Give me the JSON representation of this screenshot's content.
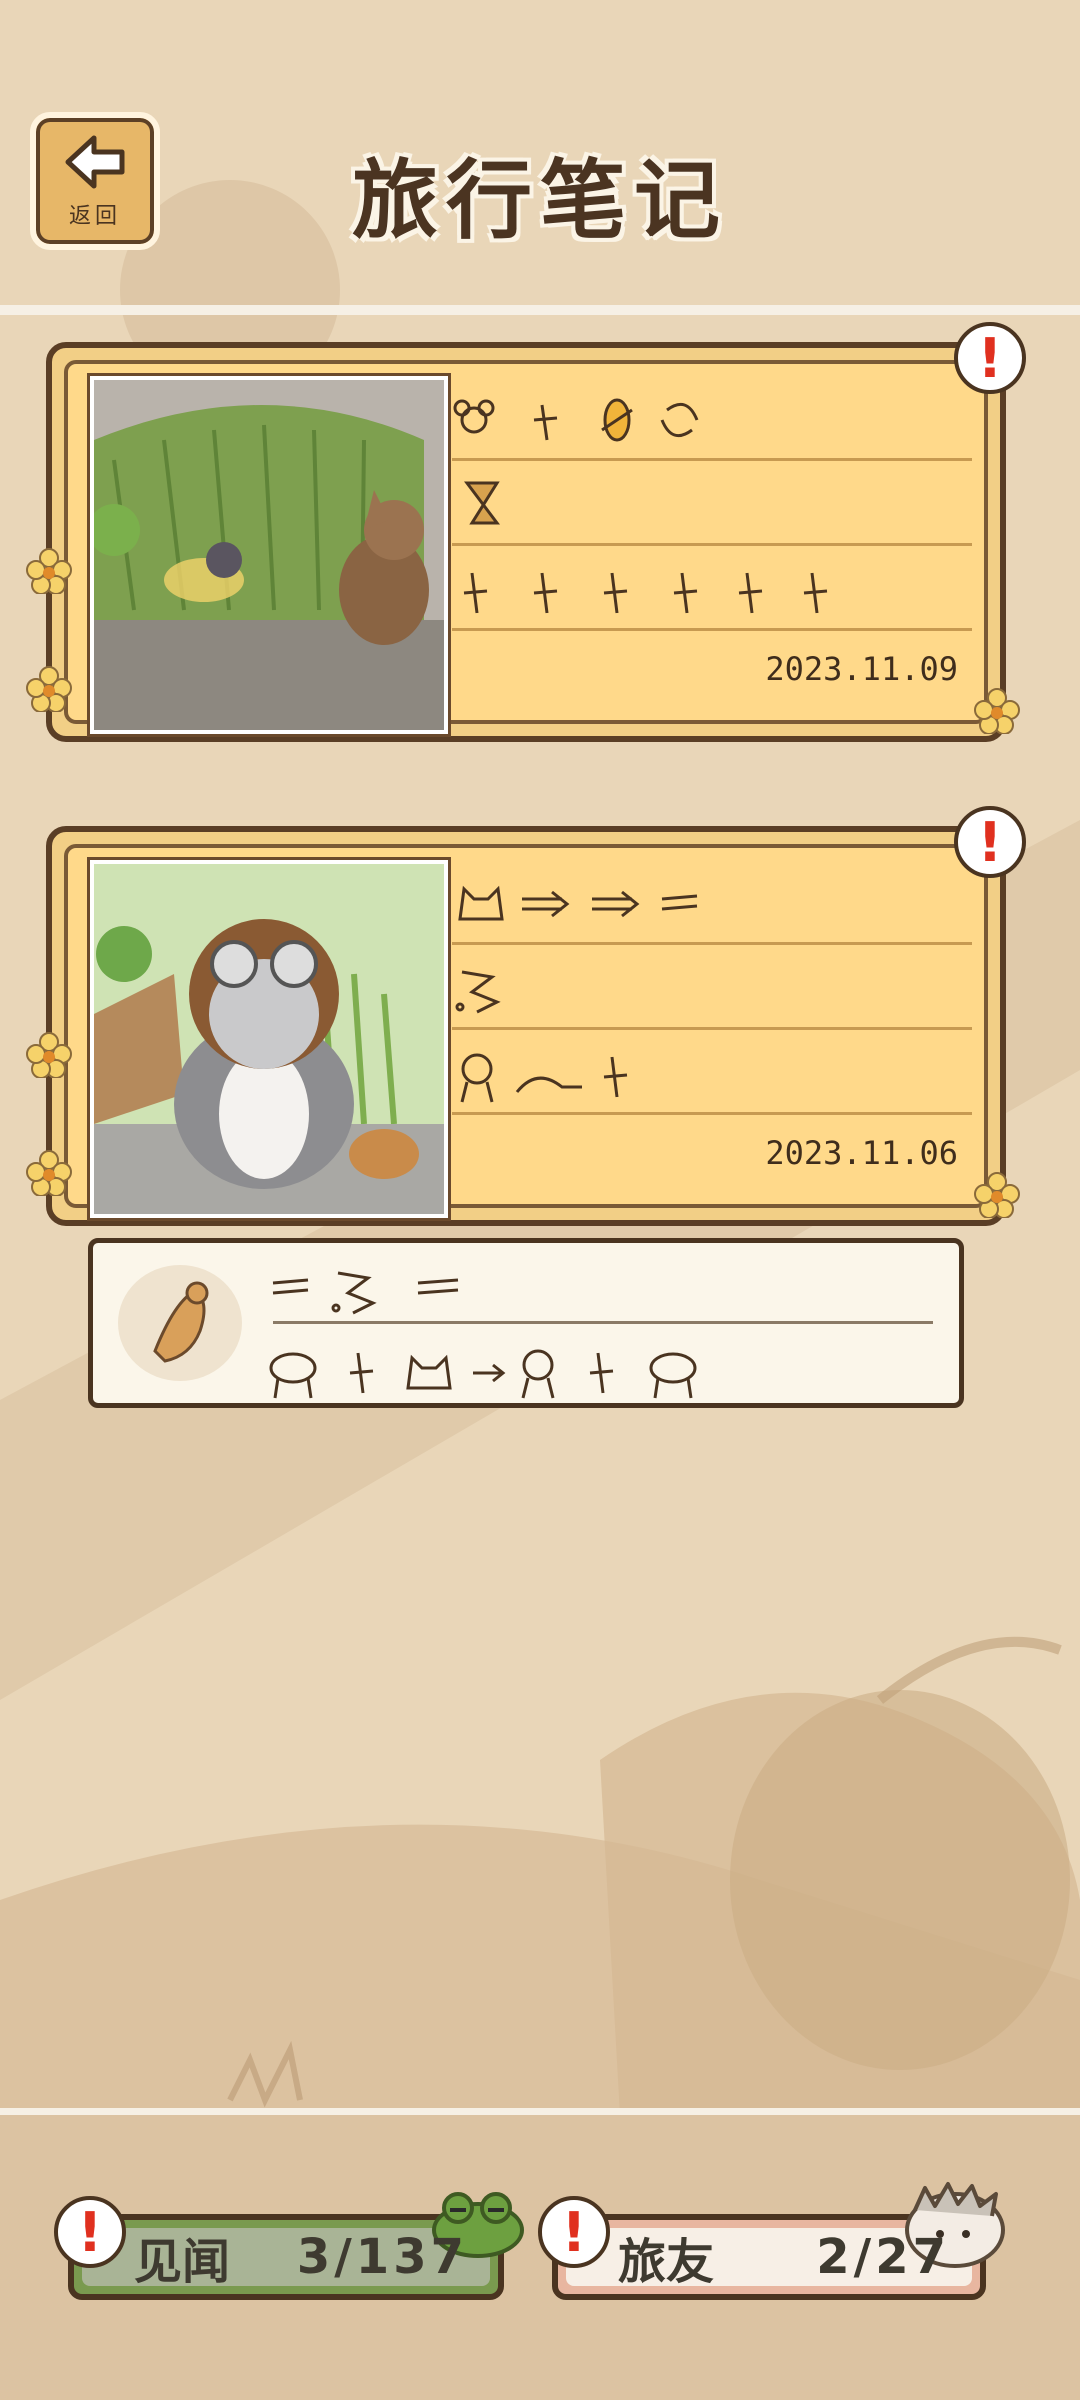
{
  "header": {
    "back_label": "返回",
    "title": "旅行笔记"
  },
  "notes": [
    {
      "date": "2023.11.09",
      "alert": "!"
    },
    {
      "date": "2023.11.06",
      "alert": "!"
    }
  ],
  "counters": {
    "sights": {
      "label": "见闻",
      "value": "3/137",
      "alert": "!"
    },
    "friends": {
      "label": "旅友",
      "value": "2/27",
      "alert": "!"
    }
  },
  "colors": {
    "background": "#e9d6b8",
    "card": "#ffd98a",
    "alert": "#e0301f",
    "sights_counter": "#7a9a4f",
    "friends_counter": "#e8b6a0"
  }
}
